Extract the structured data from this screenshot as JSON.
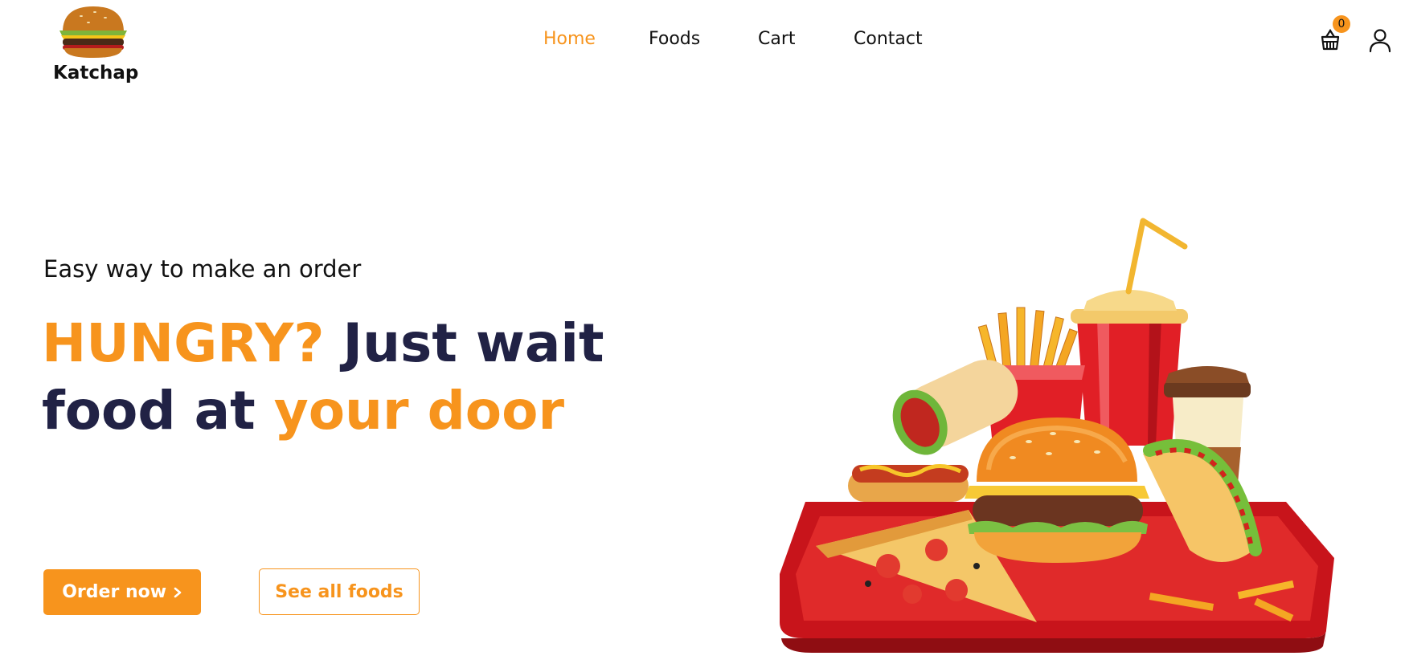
{
  "brand": {
    "name": "Katchap"
  },
  "nav": {
    "items": [
      {
        "label": "Home",
        "active": true
      },
      {
        "label": "Foods",
        "active": false
      },
      {
        "label": "Cart",
        "active": false
      },
      {
        "label": "Contact",
        "active": false
      }
    ]
  },
  "header": {
    "cart_count": "0",
    "cart_icon": "shopping-basket-icon",
    "user_icon": "user-icon"
  },
  "hero": {
    "subtitle": "Easy way to make an order",
    "headline": {
      "part1": "HUNGRY?",
      "part2": " Just wait",
      "part3": "food at ",
      "part4": "your door"
    },
    "order_button": "Order now",
    "order_button_icon": "chevron-right-icon",
    "see_all_button": "See all foods"
  },
  "colors": {
    "accent": "#f7941d",
    "heading": "#212245",
    "tray": "#c8141b"
  }
}
